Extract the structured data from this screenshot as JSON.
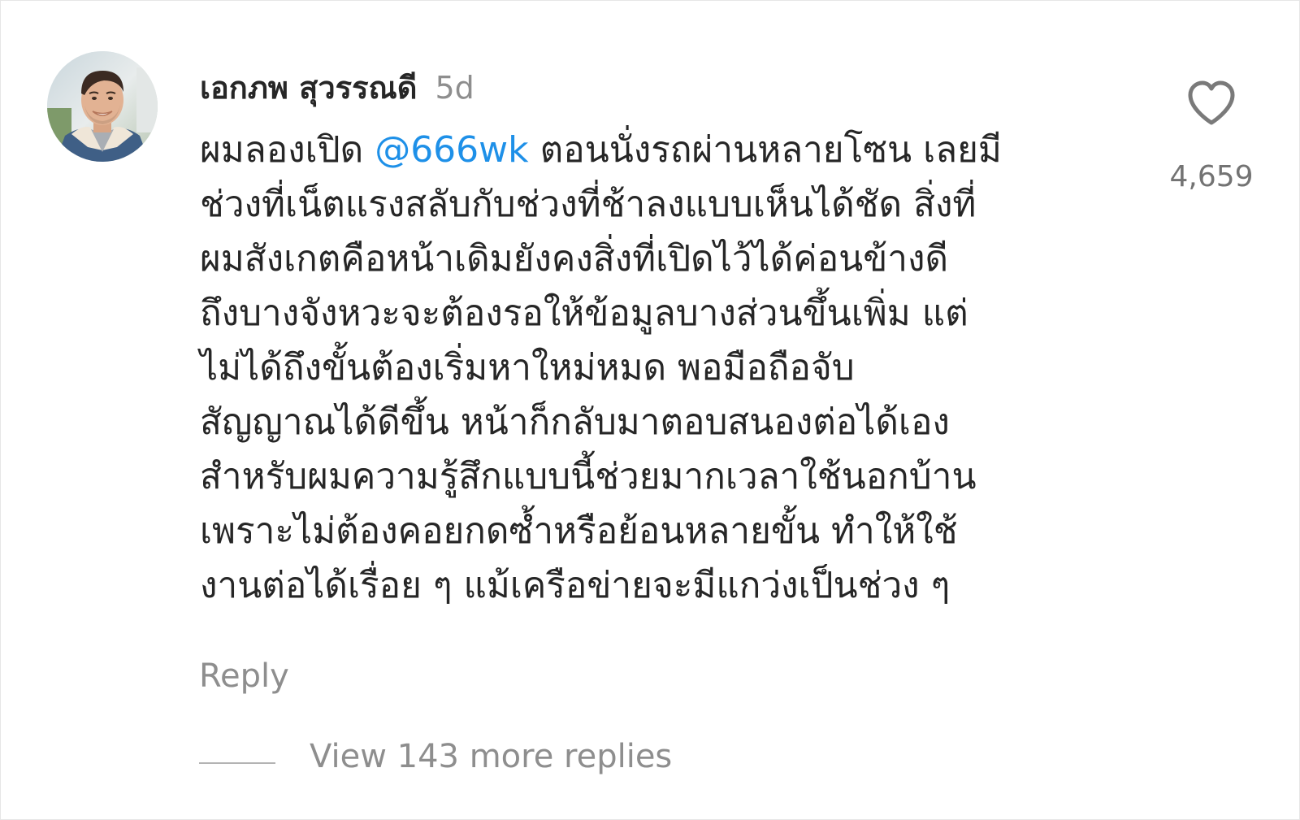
{
  "comment": {
    "username": "เอกภพ สุวรรณดี",
    "time_ago": "5d",
    "mention": "@666wk",
    "lines": [
      {
        "before": "ผมลองเปิด ",
        "after": " ตอนนั่งรถผ่านหลายโซน เลยมี"
      },
      "ช่วงที่เน็ตแรงสลับกับช่วงที่ช้าลงแบบเห็นได้ชัด สิ่งที่",
      "ผมสังเกตคือหน้าเดิมยังคงสิ่งที่เปิดไว้ได้ค่อนข้างดี",
      "ถึงบางจังหวะจะต้องรอให้ข้อมูลบางส่วนขึ้นเพิ่ม แต่",
      "ไม่ได้ถึงขั้นต้องเริ่มหาใหม่หมด พอมือถือจับ",
      "สัญญาณได้ดีขึ้น หน้าก็กลับมาตอบสนองต่อได้เอง",
      "สำหรับผมความรู้สึกแบบนี้ช่วยมากเวลาใช้นอกบ้าน",
      "เพราะไม่ต้องคอยกดซ้ำหรือย้อนหลายขั้น ทำให้ใช้",
      "งานต่อได้เรื่อย ๆ แม้เครือข่ายจะมีแกว่งเป็นช่วง ๆ"
    ],
    "like_icon": "heart-outline-icon",
    "like_count": "4,659",
    "reply_label": "Reply",
    "view_replies_label": "View 143 more replies"
  },
  "colors": {
    "text": "#262626",
    "secondary": "#8e8e8e",
    "mention": "#1e90e8",
    "background": "#ffffff"
  }
}
